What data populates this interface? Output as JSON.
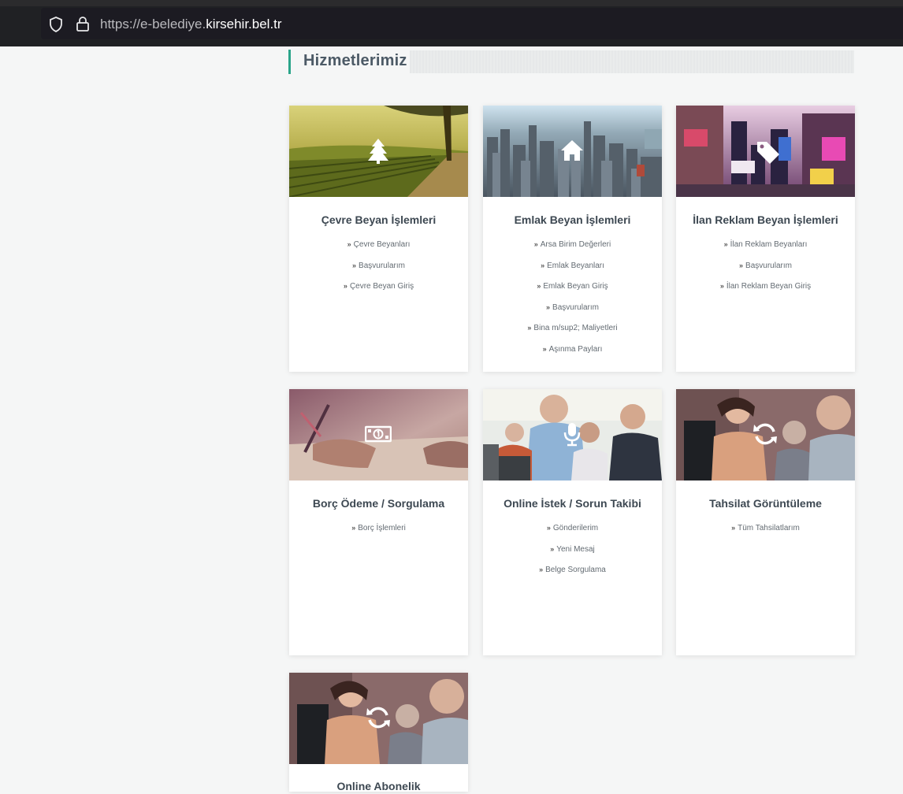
{
  "browser": {
    "url_prefix": "https://e-belediye.",
    "url_host": "kirsehir.bel.tr"
  },
  "section": {
    "title": "Hizmetlerimiz"
  },
  "cards": [
    {
      "title": "Çevre Beyan İşlemleri",
      "icon": "tree-icon",
      "links": [
        "Çevre Beyanları",
        "Başvurularım",
        "Çevre Beyan Giriş"
      ]
    },
    {
      "title": "Emlak Beyan İşlemleri",
      "icon": "home-icon",
      "links": [
        "Arsa Birim Değerleri",
        "Emlak Beyanları",
        "Emlak Beyan Giriş",
        "Başvurularım",
        "Bina m/sup2; Maliyetleri",
        "Aşınma Payları"
      ]
    },
    {
      "title": "İlan Reklam Beyan İşlemleri",
      "icon": "tag-icon",
      "links": [
        "İlan Reklam Beyanları",
        "Başvurularım",
        "İlan Reklam Beyan Giriş"
      ]
    },
    {
      "title": "Borç Ödeme / Sorgulama",
      "icon": "money-icon",
      "links": [
        "Borç İşlemleri"
      ]
    },
    {
      "title": "Online İstek / Sorun Takibi",
      "icon": "microphone-icon",
      "links": [
        "Gönderilerim",
        "Yeni Mesaj",
        "Belge Sorgulama"
      ]
    },
    {
      "title": "Tahsilat Görüntüleme",
      "icon": "refresh-icon",
      "links": [
        "Tüm Tahsilatlarım"
      ]
    },
    {
      "title": "Online Abonelik",
      "icon": "refresh-icon",
      "links": []
    }
  ],
  "colors": {
    "accent": "#2aa58a",
    "card_title": "#3d4852",
    "page_bg": "#f5f6f6"
  }
}
